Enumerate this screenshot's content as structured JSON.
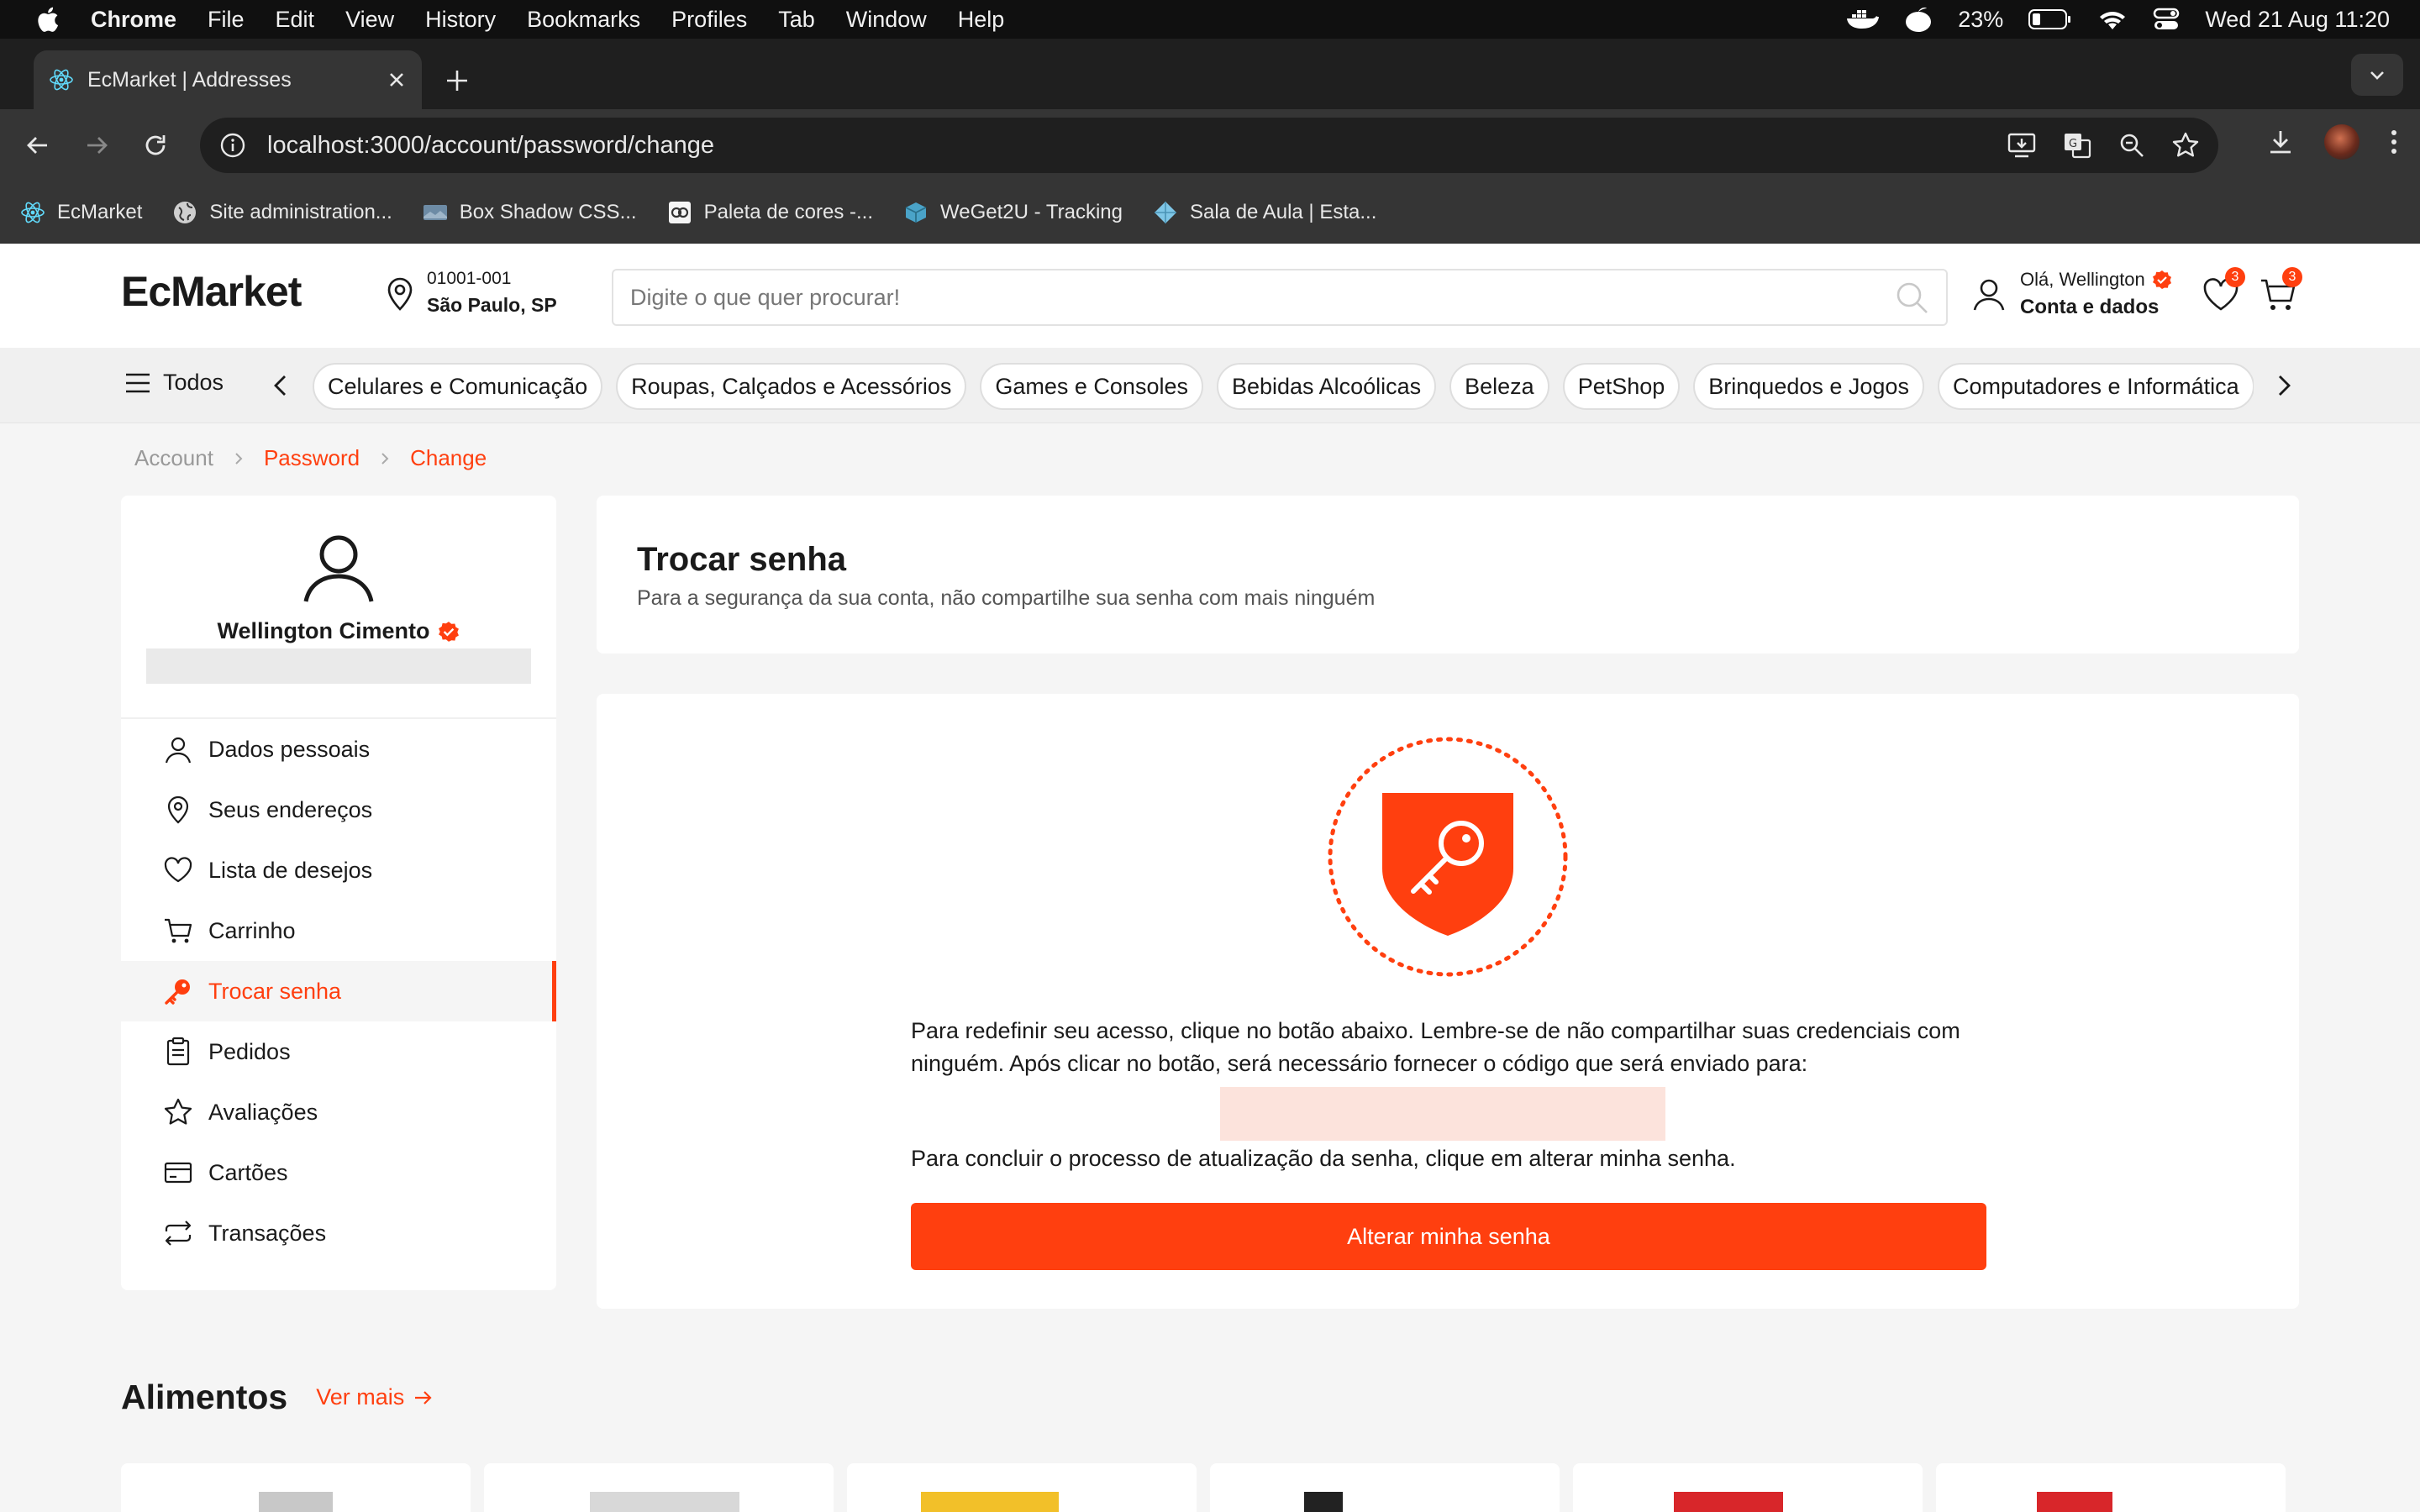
{
  "menubar": {
    "app": "Chrome",
    "items": [
      "File",
      "Edit",
      "View",
      "History",
      "Bookmarks",
      "Profiles",
      "Tab",
      "Window",
      "Help"
    ],
    "battery": "23%",
    "datetime": "Wed 21 Aug  11:20"
  },
  "tab": {
    "title": "EcMarket | Addresses"
  },
  "omnibox": {
    "url": "localhost:3000/account/password/change"
  },
  "bookmarks": [
    {
      "label": "EcMarket",
      "icon": "react-icon"
    },
    {
      "label": "Site administration...",
      "icon": "globe-icon"
    },
    {
      "label": "Box Shadow CSS...",
      "icon": "image-icon"
    },
    {
      "label": "Paleta de cores -...",
      "icon": "palette-icon"
    },
    {
      "label": "WeGet2U - Tracking",
      "icon": "box-icon"
    },
    {
      "label": "Sala de Aula | Esta...",
      "icon": "diamond-icon"
    }
  ],
  "header": {
    "logo": "EcMarket",
    "cep": "01001-001",
    "city": "São Paulo, SP",
    "search_placeholder": "Digite o que quer procurar!",
    "greeting": "Olá, Wellington",
    "account_label": "Conta e dados",
    "wishlist_count": "3",
    "cart_count": "3"
  },
  "categories": {
    "all_label": "Todos",
    "items": [
      "Celulares e Comunicação",
      "Roupas, Calçados e Acessórios",
      "Games e Consoles",
      "Bebidas Alcoólicas",
      "Beleza",
      "PetShop",
      "Brinquedos e Jogos",
      "Computadores e Informática"
    ]
  },
  "breadcrumb": [
    "Account",
    "Password",
    "Change"
  ],
  "profile": {
    "name": "Wellington Cimento",
    "menu": [
      {
        "label": "Dados pessoais",
        "icon": "user-icon"
      },
      {
        "label": "Seus endereços",
        "icon": "location-pin-icon"
      },
      {
        "label": "Lista de desejos",
        "icon": "heart-icon"
      },
      {
        "label": "Carrinho",
        "icon": "cart-icon"
      },
      {
        "label": "Trocar senha",
        "icon": "key-icon"
      },
      {
        "label": "Pedidos",
        "icon": "clipboard-icon"
      },
      {
        "label": "Avaliações",
        "icon": "star-icon"
      },
      {
        "label": "Cartões",
        "icon": "card-icon"
      },
      {
        "label": "Transações",
        "icon": "transfer-icon"
      }
    ]
  },
  "page": {
    "title": "Trocar senha",
    "subtitle": "Para a segurança da sua conta, não compartilhe sua senha com mais ninguém",
    "instructions": "Para redefinir seu acesso, clique no botão abaixo. Lembre-se de não compartilhar suas credenciais com ninguém. Após clicar no botão, será necessário fornecer o código que será enviado para:",
    "conclusion": "Para concluir o processo de atualização da senha, clique em alterar minha senha.",
    "button_label": "Alterar minha senha"
  },
  "section": {
    "title": "Alimentos",
    "see_more": "Ver mais"
  },
  "colors": {
    "accent": "#ff3f0f",
    "text": "#1a1a1a"
  }
}
